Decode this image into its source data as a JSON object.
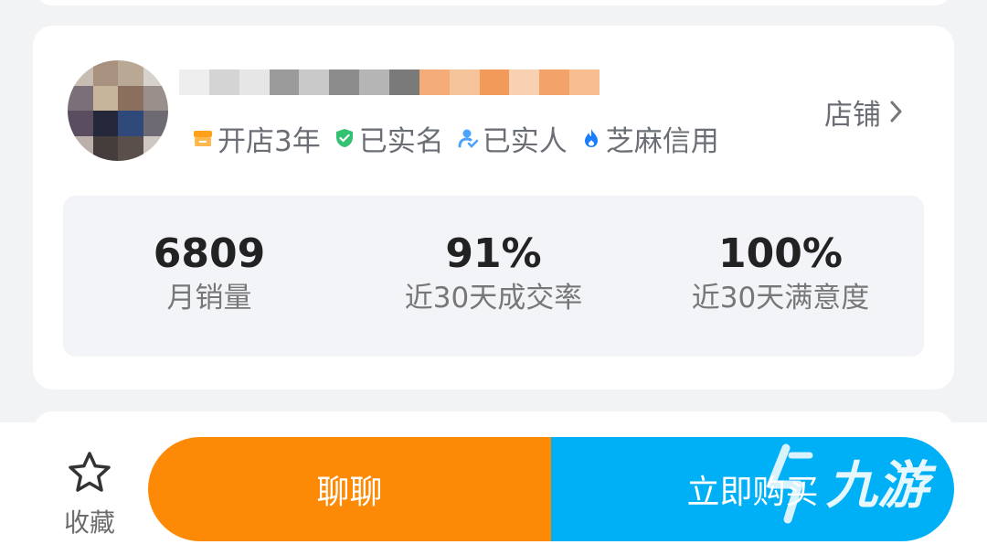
{
  "shop": {
    "store_label": "店铺",
    "badges": [
      {
        "label": "开店3年",
        "icon": "shop-icon",
        "color": "#ffa21a"
      },
      {
        "label": "已实名",
        "icon": "shield-check-icon",
        "color": "#34c272"
      },
      {
        "label": "已实人",
        "icon": "person-check-icon",
        "color": "#4aa3ff"
      },
      {
        "label": "芝麻信用",
        "icon": "flame-icon",
        "color": "#1a7dff"
      }
    ],
    "stats": [
      {
        "value": "6809",
        "label": "月销量"
      },
      {
        "value": "91%",
        "label": "近30天成交率"
      },
      {
        "value": "100%",
        "label": "近30天满意度"
      }
    ]
  },
  "bottom_bar": {
    "favorite_label": "收藏",
    "chat_label": "聊聊",
    "buy_label": "立即购买"
  },
  "colors": {
    "chat": "#fd8a06",
    "buy": "#00b0f6"
  },
  "watermark": {
    "text": "九游"
  }
}
